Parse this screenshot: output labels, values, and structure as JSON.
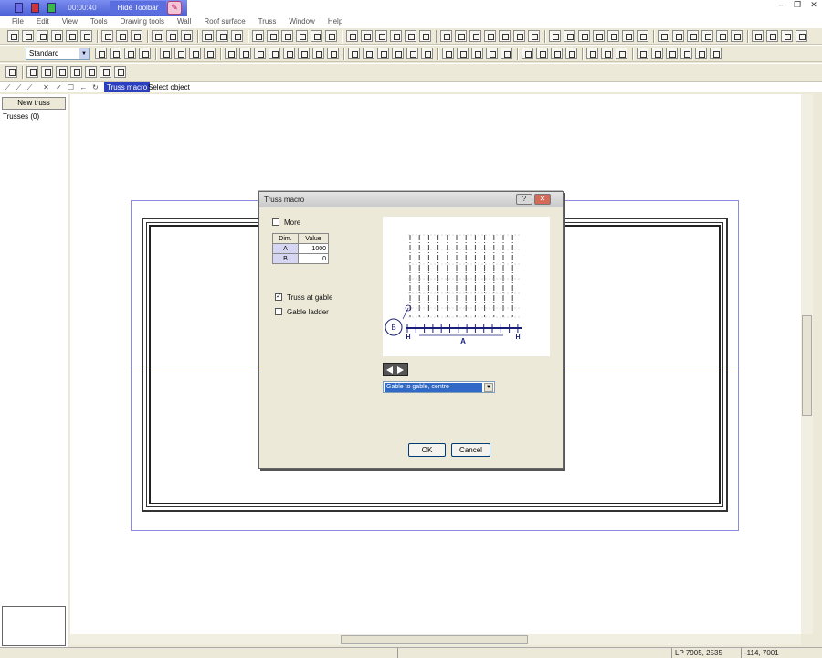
{
  "recorder": {
    "time": "00:00:40",
    "hide_label": "Hide Toolbar"
  },
  "menu": [
    "File",
    "Edit",
    "View",
    "Tools",
    "Drawing tools",
    "Wall",
    "Roof surface",
    "Truss",
    "Window",
    "Help"
  ],
  "toolbar": {
    "style_value": "Standard"
  },
  "command": {
    "name": "Truss macro",
    "prompt": "Select object"
  },
  "left_panel": {
    "new_truss": "New truss",
    "trusses": "Trusses (0)"
  },
  "dialog": {
    "title": "Truss macro",
    "more_label": "More",
    "table": {
      "headers": [
        "Dim.",
        "Value"
      ],
      "rows": [
        {
          "dim": "A",
          "value": "1000"
        },
        {
          "dim": "B",
          "value": "0"
        }
      ]
    },
    "truss_at_gable_label": "Truss at gable",
    "truss_at_gable_checked": true,
    "gable_ladder_label": "Gable ladder",
    "gable_ladder_checked": false,
    "more_checked": false,
    "preview_labels": {
      "left": "H",
      "center": "A",
      "right": "H",
      "circle": "B"
    },
    "type_value": "Gable to gable, centre",
    "ok": "OK",
    "cancel": "Cancel"
  },
  "status": {
    "lp": "LP 7905, 2535",
    "coords": "-114, 7001"
  }
}
